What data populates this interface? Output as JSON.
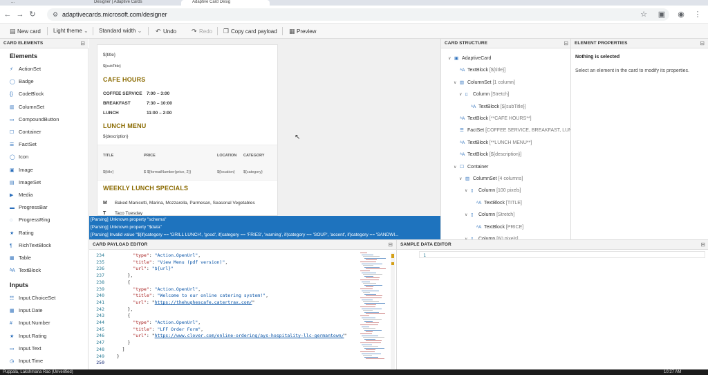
{
  "browser": {
    "tabs": [
      {
        "label": "...",
        "active": false
      },
      {
        "label": "Designer | Adaptive Cards",
        "active": false
      },
      {
        "label": "Adaptive Card Desig",
        "active": true
      },
      {
        "label": "",
        "active": false
      }
    ],
    "url": "adaptivecards.microsoft.com/designer"
  },
  "toolbar": {
    "new_card": "New card",
    "theme": "Light theme",
    "width": "Standard width",
    "undo": "Undo",
    "redo": "Redo",
    "copy_payload": "Copy card payload",
    "preview": "Preview"
  },
  "card_elements": {
    "header": "CARD ELEMENTS",
    "elements_title": "Elements",
    "elements": [
      {
        "label": "ActionSet",
        "icon": "action-set-icon"
      },
      {
        "label": "Badge",
        "icon": "badge-icon"
      },
      {
        "label": "CodeBlock",
        "icon": "code-icon"
      },
      {
        "label": "ColumnSet",
        "icon": "columns-icon"
      },
      {
        "label": "CompoundButton",
        "icon": "button-icon"
      },
      {
        "label": "Container",
        "icon": "container-icon"
      },
      {
        "label": "FactSet",
        "icon": "list-icon"
      },
      {
        "label": "Icon",
        "icon": "circle-icon"
      },
      {
        "label": "Image",
        "icon": "image-icon"
      },
      {
        "label": "ImageSet",
        "icon": "images-icon"
      },
      {
        "label": "Media",
        "icon": "media-icon"
      },
      {
        "label": "ProgressBar",
        "icon": "progress-icon"
      },
      {
        "label": "ProgressRing",
        "icon": "ring-icon"
      },
      {
        "label": "Rating",
        "icon": "star-icon"
      },
      {
        "label": "RichTextBlock",
        "icon": "richtext-icon"
      },
      {
        "label": "Table",
        "icon": "table-icon"
      },
      {
        "label": "TextBlock",
        "icon": "text-icon"
      }
    ],
    "inputs_title": "Inputs",
    "inputs": [
      {
        "label": "Input.ChoiceSet",
        "icon": "choice-icon"
      },
      {
        "label": "Input.Date",
        "icon": "calendar-icon"
      },
      {
        "label": "Input.Number",
        "icon": "number-icon"
      },
      {
        "label": "Input.Rating",
        "icon": "star-icon"
      },
      {
        "label": "Input.Text",
        "icon": "textbox-icon"
      },
      {
        "label": "Input.Time",
        "icon": "clock-icon"
      }
    ]
  },
  "card": {
    "title": "${title}",
    "subtitle": "${subTitle}",
    "cafe_hours_heading": "CAFE HOURS",
    "facts": [
      {
        "key": "COFFEE SERVICE",
        "value": "7:00 – 3:00"
      },
      {
        "key": "BREAKFAST",
        "value": "7:30 – 10:00"
      },
      {
        "key": "LUNCH",
        "value": "11:00 – 2:00"
      }
    ],
    "lunch_menu_heading": "LUNCH MENU",
    "description": "${description}",
    "table_headers": [
      "TITLE",
      "PRICE",
      "LOCATION",
      "CATEGORY"
    ],
    "table_row": [
      "${title}",
      "$ ${formatNumber(price, 2)}",
      "${location}",
      "${category}"
    ],
    "specials_heading": "WEEKLY LUNCH SPECIALS",
    "specials": [
      {
        "day": "M",
        "text": "Baked Manicotti, Marina, Mozzarella, Parmesan, Seasonal Vegetables"
      },
      {
        "day": "T",
        "text": "Taco Tuesday"
      }
    ]
  },
  "errors": [
    "[Parsing] Unknown property \"schema\"",
    "[Parsing] Unknown property \"$data\"",
    "[Parsing] Invalid value \"${if(category == 'GRILL LUNCH', 'good', if(category == 'FRIES', 'warning', if(category == 'SOUP', 'accent', if(category == 'SANDWI..."
  ],
  "structure": {
    "header": "CARD STRUCTURE",
    "nodes": [
      {
        "chev": "∨",
        "icon": "card-icon",
        "name": "AdaptiveCard",
        "desc": ""
      },
      {
        "chev": "",
        "icon": "text-icon",
        "name": "TextBlock",
        "desc": "[${title}]"
      },
      {
        "chev": "∨",
        "icon": "columns-icon",
        "name": "ColumnSet",
        "desc": "[1 column]"
      },
      {
        "chev": "∨",
        "icon": "column-icon",
        "name": "Column",
        "desc": "[Stretch]"
      },
      {
        "chev": "",
        "icon": "text-icon",
        "name": "TextBlock",
        "desc": "[${subTitle}]"
      },
      {
        "chev": "",
        "icon": "text-icon",
        "name": "TextBlock",
        "desc": "[**CAFE HOURS**]"
      },
      {
        "chev": "",
        "icon": "list-icon",
        "name": "FactSet",
        "desc": "[COFFEE SERVICE, BREAKFAST, LUNCH]"
      },
      {
        "chev": "",
        "icon": "text-icon",
        "name": "TextBlock",
        "desc": "[**LUNCH MENU**]"
      },
      {
        "chev": "",
        "icon": "text-icon",
        "name": "TextBlock",
        "desc": "[${description}]"
      },
      {
        "chev": "∨",
        "icon": "container-icon",
        "name": "Container",
        "desc": ""
      },
      {
        "chev": "∨",
        "icon": "columns-icon",
        "name": "ColumnSet",
        "desc": "[4 columns]"
      },
      {
        "chev": "∨",
        "icon": "column-icon",
        "name": "Column",
        "desc": "[100 pixels]"
      },
      {
        "chev": "",
        "icon": "text-icon",
        "name": "TextBlock",
        "desc": "[TITLE]"
      },
      {
        "chev": "∨",
        "icon": "column-icon",
        "name": "Column",
        "desc": "[Stretch]"
      },
      {
        "chev": "",
        "icon": "text-icon",
        "name": "TextBlock",
        "desc": "[PRICE]"
      },
      {
        "chev": "∨",
        "icon": "column-icon",
        "name": "Column",
        "desc": "[60 pixels]"
      }
    ]
  },
  "properties": {
    "header": "ELEMENT PROPERTIES",
    "title": "Nothing is selected",
    "hint": "Select an element in the card to modify its properties."
  },
  "payload_editor": {
    "header": "CARD PAYLOAD EDITOR",
    "line_numbers": [
      "234",
      "235",
      "236",
      "237",
      "238",
      "239",
      "240",
      "241",
      "242",
      "243",
      "244",
      "245",
      "246",
      "247",
      "248",
      "249",
      "250"
    ],
    "lines": [
      "        \"type\": \"Action.OpenUrl\",",
      "        \"title\": \"View Menu (pdf version)\",",
      "        \"url\": \"${url}\"",
      "      },",
      "      {",
      "        \"type\": \"Action.OpenUrl\",",
      "        \"title\": \"Welcome to our online catering system!\",",
      "        \"url\": \"https://thehughescafe.catertrax.com/\"",
      "      },",
      "      {",
      "        \"type\": \"Action.OpenUrl\",",
      "        \"title\": \"LFF Order Form\",",
      "        \"url\": \"https://www.clover.com/online-ordering/ays-hospitality-llc-germantown/\"",
      "      }",
      "    ]",
      "  }",
      ""
    ]
  },
  "sample_editor": {
    "header": "SAMPLE DATA EDITOR",
    "line_numbers": [
      "1"
    ]
  },
  "taskbar": {
    "user": "Puppala, Lakshmana Rao (Unverified)",
    "time": "10:27 AM"
  },
  "colors": {
    "accent": "#1e73be",
    "heading": "#8a6a00"
  }
}
